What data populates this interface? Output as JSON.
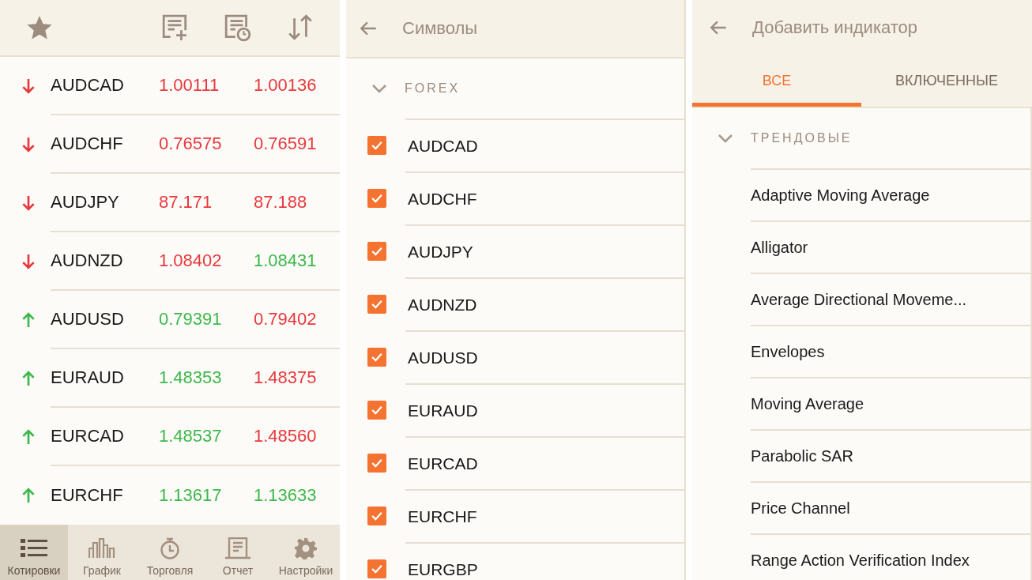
{
  "quotes": {
    "rows": [
      {
        "symbol": "AUDCAD",
        "rising": false,
        "bid": "1.00111",
        "bid_rising": false,
        "ask": "1.00136",
        "ask_rising": false
      },
      {
        "symbol": "AUDCHF",
        "rising": false,
        "bid": "0.76575",
        "bid_rising": false,
        "ask": "0.76591",
        "ask_rising": false
      },
      {
        "symbol": "AUDJPY",
        "rising": false,
        "bid": "87.171",
        "bid_rising": false,
        "ask": "87.188",
        "ask_rising": false
      },
      {
        "symbol": "AUDNZD",
        "rising": false,
        "bid": "1.08402",
        "bid_rising": false,
        "ask": "1.08431",
        "ask_rising": true
      },
      {
        "symbol": "AUDUSD",
        "rising": true,
        "bid": "0.79391",
        "bid_rising": true,
        "ask": "0.79402",
        "ask_rising": false
      },
      {
        "symbol": "EURAUD",
        "rising": true,
        "bid": "1.48353",
        "bid_rising": true,
        "ask": "1.48375",
        "ask_rising": false
      },
      {
        "symbol": "EURCAD",
        "rising": true,
        "bid": "1.48537",
        "bid_rising": true,
        "ask": "1.48560",
        "ask_rising": false
      },
      {
        "symbol": "EURCHF",
        "rising": true,
        "bid": "1.13617",
        "bid_rising": true,
        "ask": "1.13633",
        "ask_rising": true
      }
    ],
    "nav": [
      {
        "label": "Котировки",
        "kind": "list",
        "selected": true
      },
      {
        "label": "График",
        "kind": "chart",
        "selected": false
      },
      {
        "label": "Торговля",
        "kind": "timer",
        "selected": false
      },
      {
        "label": "Отчет",
        "kind": "report",
        "selected": false
      },
      {
        "label": "Настройки",
        "kind": "gear",
        "selected": false
      }
    ]
  },
  "symbols": {
    "title": "Символы",
    "group": {
      "label": "FOREX",
      "expanded": true
    },
    "items": [
      {
        "label": "AUDCAD",
        "checked": true
      },
      {
        "label": "AUDCHF",
        "checked": true
      },
      {
        "label": "AUDJPY",
        "checked": true
      },
      {
        "label": "AUDNZD",
        "checked": true
      },
      {
        "label": "AUDUSD",
        "checked": true
      },
      {
        "label": "EURAUD",
        "checked": true
      },
      {
        "label": "EURCAD",
        "checked": true
      },
      {
        "label": "EURCHF",
        "checked": true
      },
      {
        "label": "EURGBP",
        "checked": true
      }
    ]
  },
  "indicators": {
    "title": "Добавить индикатор",
    "tabs": [
      {
        "label": "ВСЕ",
        "selected": true
      },
      {
        "label": "ВКЛЮЧЕННЫЕ",
        "selected": false
      }
    ],
    "group": {
      "label": "ТРЕНДОВЫЕ",
      "expanded": true
    },
    "items": [
      "Adaptive Moving Average",
      "Alligator",
      "Average Directional Moveme...",
      "Envelopes",
      "Moving Average",
      "Parabolic SAR",
      "Price Channel",
      "Range Action Verification Index"
    ]
  }
}
